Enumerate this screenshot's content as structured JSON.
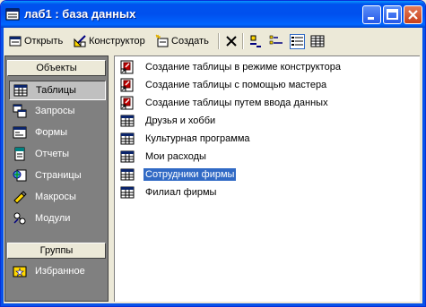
{
  "window": {
    "title": "лаб1 : база данных"
  },
  "toolbar": {
    "open_label": "Открыть",
    "design_label": "Конструктор",
    "create_label": "Создать"
  },
  "panel": {
    "objects_header": "Объекты",
    "groups_header": "Группы",
    "items": [
      {
        "label": "Таблицы",
        "icon": "table-icon",
        "selected": true
      },
      {
        "label": "Запросы",
        "icon": "query-icon"
      },
      {
        "label": "Формы",
        "icon": "form-icon"
      },
      {
        "label": "Отчеты",
        "icon": "report-icon"
      },
      {
        "label": "Страницы",
        "icon": "page-icon"
      },
      {
        "label": "Макросы",
        "icon": "macro-icon"
      },
      {
        "label": "Модули",
        "icon": "module-icon"
      }
    ],
    "group_items": [
      {
        "label": "Избранное",
        "icon": "favorites-icon"
      }
    ]
  },
  "objects": [
    {
      "label": "Создание таблицы в режиме конструктора",
      "icon": "shortcut-icon"
    },
    {
      "label": "Создание таблицы с помощью мастера",
      "icon": "shortcut-icon"
    },
    {
      "label": "Создание таблицы путем ввода данных",
      "icon": "shortcut-icon"
    },
    {
      "label": "Друзья и хобби",
      "icon": "table-icon"
    },
    {
      "label": "Культурная программа",
      "icon": "table-icon"
    },
    {
      "label": "Мои расходы",
      "icon": "table-icon"
    },
    {
      "label": "Сотрудники фирмы",
      "icon": "table-icon",
      "selected": true
    },
    {
      "label": "Филиал фирмы",
      "icon": "table-icon"
    }
  ]
}
